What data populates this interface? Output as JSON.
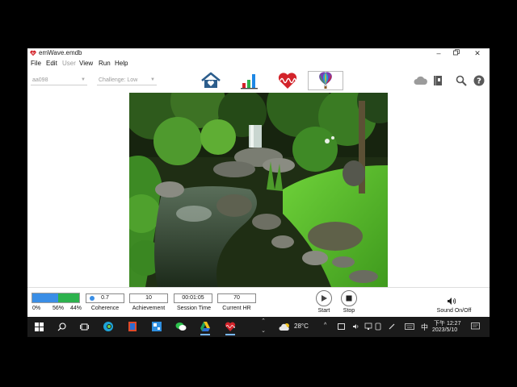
{
  "window": {
    "title": "emWave.emdb",
    "menu": [
      {
        "label": "File",
        "enabled": true
      },
      {
        "label": "Edit",
        "enabled": true
      },
      {
        "label": "User",
        "enabled": false
      },
      {
        "label": "View",
        "enabled": true
      },
      {
        "label": "Run",
        "enabled": true
      },
      {
        "label": "Help",
        "enabled": true
      }
    ]
  },
  "toolbar": {
    "user_dropdown": "aa098",
    "challenge_dropdown": "Challenge: Low",
    "nav": [
      {
        "id": "home",
        "icon": "home-icon"
      },
      {
        "id": "reports",
        "icon": "bar-chart-icon"
      },
      {
        "id": "heart-rhythm",
        "icon": "heart-wave-icon"
      },
      {
        "id": "balloon",
        "icon": "balloon-icon",
        "active": true
      }
    ],
    "right_icons": [
      "cloud-icon",
      "book-icon",
      "search-icon",
      "help-icon"
    ]
  },
  "status": {
    "coherence_bar": {
      "low": 0,
      "medium": 56,
      "high": 44
    },
    "pct_low": "0%",
    "pct_medium": "56%",
    "pct_high": "44%",
    "coherence": {
      "value": "0.7",
      "label": "Coherence"
    },
    "achievement": {
      "value": "10",
      "label": "Achievement"
    },
    "session_time": {
      "value": "00:01:05",
      "label": "Session Time"
    },
    "current_hr": {
      "value": "70",
      "label": "Current HR"
    },
    "start_label": "Start",
    "stop_label": "Stop",
    "sound_label": "Sound On/Off"
  },
  "taskbar": {
    "weather": "28°C",
    "ime": "中",
    "time": "下午 12:27",
    "date": "2023/5/10"
  },
  "colors": {
    "accent_blue": "#1e88e5",
    "coherence_blue": "#3a8ee6",
    "coherence_green": "#2db24d",
    "heart_red": "#d3232a",
    "home_blue": "#2c5d8c"
  }
}
